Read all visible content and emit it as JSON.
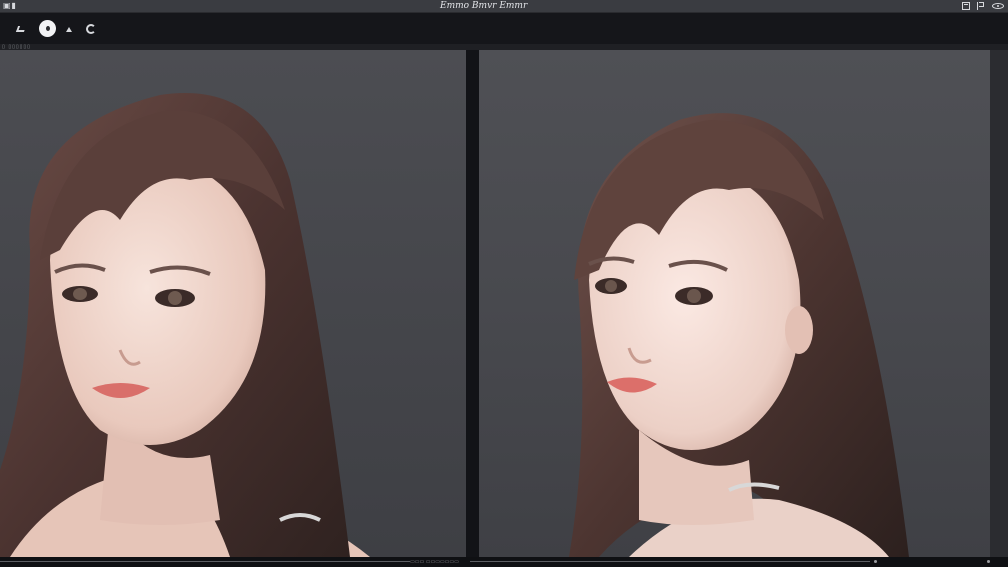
{
  "window": {
    "title": "Emmo Bmvr Emmr"
  },
  "toolbar": {
    "tools": [
      {
        "icon": "brush-icon"
      },
      {
        "icon": "circle-cursor-icon"
      },
      {
        "icon": "arrow-up-icon"
      },
      {
        "icon": "rotate-icon"
      }
    ]
  },
  "colors": {
    "app_bg": "#1b1c20",
    "toolbar_bg": "#15161a",
    "canvas_bg": "#48494e",
    "hair": "#5b3f3a",
    "skin": "#f1d9cf",
    "lips": "#d96f6a"
  },
  "canvas": {
    "left_label": "",
    "right_label": ""
  }
}
